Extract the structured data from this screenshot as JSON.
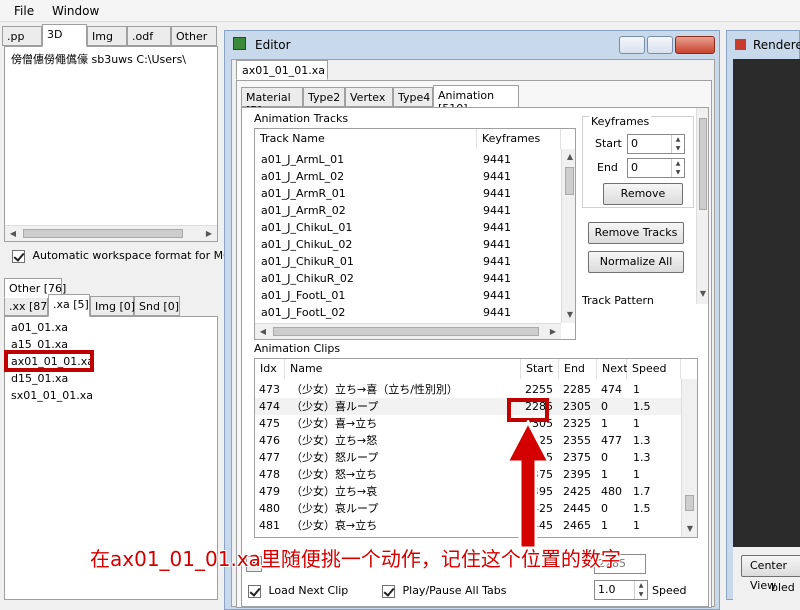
{
  "menu": {
    "file": "File",
    "window": "Window"
  },
  "left_tabs_top": [
    ".pp",
    "3D",
    "Img",
    ".odf",
    "Other"
  ],
  "file_list": {
    "line": "傍僧僡僗僶儰儫 sb3uws  C:\\Users\\"
  },
  "auto_workspace": {
    "label": "Automatic workspace format for MQO",
    "checked": true
  },
  "other_tab": "Other [76]",
  "left_tabs_bottom": [
    ".xx [87]",
    ".xa [5]",
    "Img [0]",
    "Snd [0]"
  ],
  "xa_files": [
    "a01_01.xa",
    "a15_01.xa",
    "ax01_01_01.xa",
    "d15_01.xa",
    "sx01_01_01.xa"
  ],
  "editor": {
    "title": "Editor",
    "file_tab": "ax01_01_01.xa",
    "tabs": [
      "Material [5]",
      "Type2",
      "Vertex",
      "Type4",
      "Animation [510]"
    ]
  },
  "tracks": {
    "group_label": "Animation Tracks",
    "col_name": "Track Name",
    "col_keyframes": "Keyframes",
    "rows": [
      {
        "name": "a01_J_ArmL_01",
        "kf": "9441"
      },
      {
        "name": "a01_J_ArmL_02",
        "kf": "9441"
      },
      {
        "name": "a01_J_ArmR_01",
        "kf": "9441"
      },
      {
        "name": "a01_J_ArmR_02",
        "kf": "9441"
      },
      {
        "name": "a01_J_ChikuL_01",
        "kf": "9441"
      },
      {
        "name": "a01_J_ChikuL_02",
        "kf": "9441"
      },
      {
        "name": "a01_J_ChikuR_01",
        "kf": "9441"
      },
      {
        "name": "a01_J_ChikuR_02",
        "kf": "9441"
      },
      {
        "name": "a01_J_FootL_01",
        "kf": "9441"
      },
      {
        "name": "a01_J_FootL_02",
        "kf": "9441"
      }
    ]
  },
  "keyframes": {
    "label": "Keyframes",
    "start_label": "Start",
    "start_value": "0",
    "end_label": "End",
    "end_value": "0",
    "remove": "Remove"
  },
  "remove_tracks": "Remove Tracks",
  "normalize_all": "Normalize All",
  "track_pattern": "Track Pattern",
  "clips": {
    "group_label": "Animation Clips",
    "headers": {
      "idx": "Idx",
      "name": "Name",
      "start": "Start",
      "end": "End",
      "next": "Next",
      "speed": "Speed"
    },
    "rows": [
      {
        "idx": "473",
        "name": "（少女）立ち→喜（立ち/性別別）",
        "start": "2255",
        "end": "2285",
        "next": "474",
        "speed": "1"
      },
      {
        "idx": "474",
        "name": "（少女）喜ループ",
        "start": "2285",
        "end": "2305",
        "next": "0",
        "speed": "1.5"
      },
      {
        "idx": "475",
        "name": "（少女）喜→立ち",
        "start": "2305",
        "end": "2325",
        "next": "1",
        "speed": "1"
      },
      {
        "idx": "476",
        "name": "（少女）立ち→怒",
        "start": "2325",
        "end": "2355",
        "next": "477",
        "speed": "1.3"
      },
      {
        "idx": "477",
        "name": "（少女）怒ループ",
        "start": "2355",
        "end": "2375",
        "next": "0",
        "speed": "1.3"
      },
      {
        "idx": "478",
        "name": "（少女）怒→立ち",
        "start": "2375",
        "end": "2395",
        "next": "1",
        "speed": "1"
      },
      {
        "idx": "479",
        "name": "（少女）立ち→哀",
        "start": "2395",
        "end": "2425",
        "next": "480",
        "speed": "1.7"
      },
      {
        "idx": "480",
        "name": "（少女）哀ループ",
        "start": "2425",
        "end": "2445",
        "next": "0",
        "speed": "1.5"
      },
      {
        "idx": "481",
        "name": "（少女）哀→立ち",
        "start": "2445",
        "end": "2465",
        "next": "1",
        "speed": "1"
      }
    ]
  },
  "bottom": {
    "load_next_clip": "Load Next Clip",
    "play_pause": "Play/Pause All Tabs",
    "speed_value": "1.0",
    "speed_label": "Speed",
    "frame_value": "2285"
  },
  "renderer": {
    "title": "Renderer",
    "center_view": "Center View",
    "enabled_fragment": "bled"
  },
  "annotation": {
    "text": "在ax01_01_01.xa里随便挑一个动作，记住这个位置的数字",
    "color": "#d40000"
  }
}
